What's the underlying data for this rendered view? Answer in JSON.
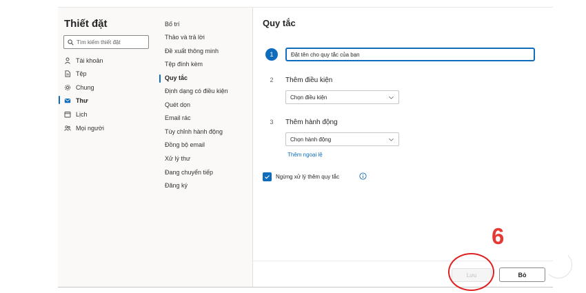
{
  "settings": {
    "title": "Thiết đặt",
    "search_placeholder": "Tìm kiếm thiết đặt",
    "categories": [
      {
        "label": "Tài khoản",
        "icon": "person-icon"
      },
      {
        "label": "Tệp",
        "icon": "file-icon"
      },
      {
        "label": "Chung",
        "icon": "gear-icon"
      },
      {
        "label": "Thư",
        "icon": "mail-icon",
        "active": true
      },
      {
        "label": "Lịch",
        "icon": "calendar-icon"
      },
      {
        "label": "Mọi người",
        "icon": "people-icon"
      }
    ],
    "mail_sections": [
      "Bố trí",
      "Thảo và trả lời",
      "Đề xuất thông minh",
      "Tệp đính kèm",
      "Quy tắc",
      "Định dạng có điều kiện",
      "Quét dọn",
      "Email rác",
      "Tùy chỉnh hành động",
      "Đồng bộ email",
      "Xử lý thư",
      "Đang chuyển tiếp",
      "Đăng ký"
    ],
    "active_section": "Quy tắc"
  },
  "rule": {
    "title": "Quy tắc",
    "steps": [
      "1",
      "2",
      "3"
    ],
    "name_placeholder": "Đặt tên cho quy tắc của bạn",
    "condition_label": "Thêm điều kiện",
    "condition_select": "Chọn điều kiện",
    "action_label": "Thêm hành động",
    "action_select": "Chọn hành động",
    "exception_link": "Thêm ngoại lệ",
    "stop_processing_label": "Ngừng xử lý thêm quy tắc",
    "stop_processing_checked": true
  },
  "footer": {
    "save_label": "Lưu",
    "save_enabled": false,
    "discard_label": "Bỏ"
  },
  "annotation": {
    "step_number": "6"
  },
  "colors": {
    "accent": "#0f6cbd",
    "annotation_red": "#e53935"
  }
}
